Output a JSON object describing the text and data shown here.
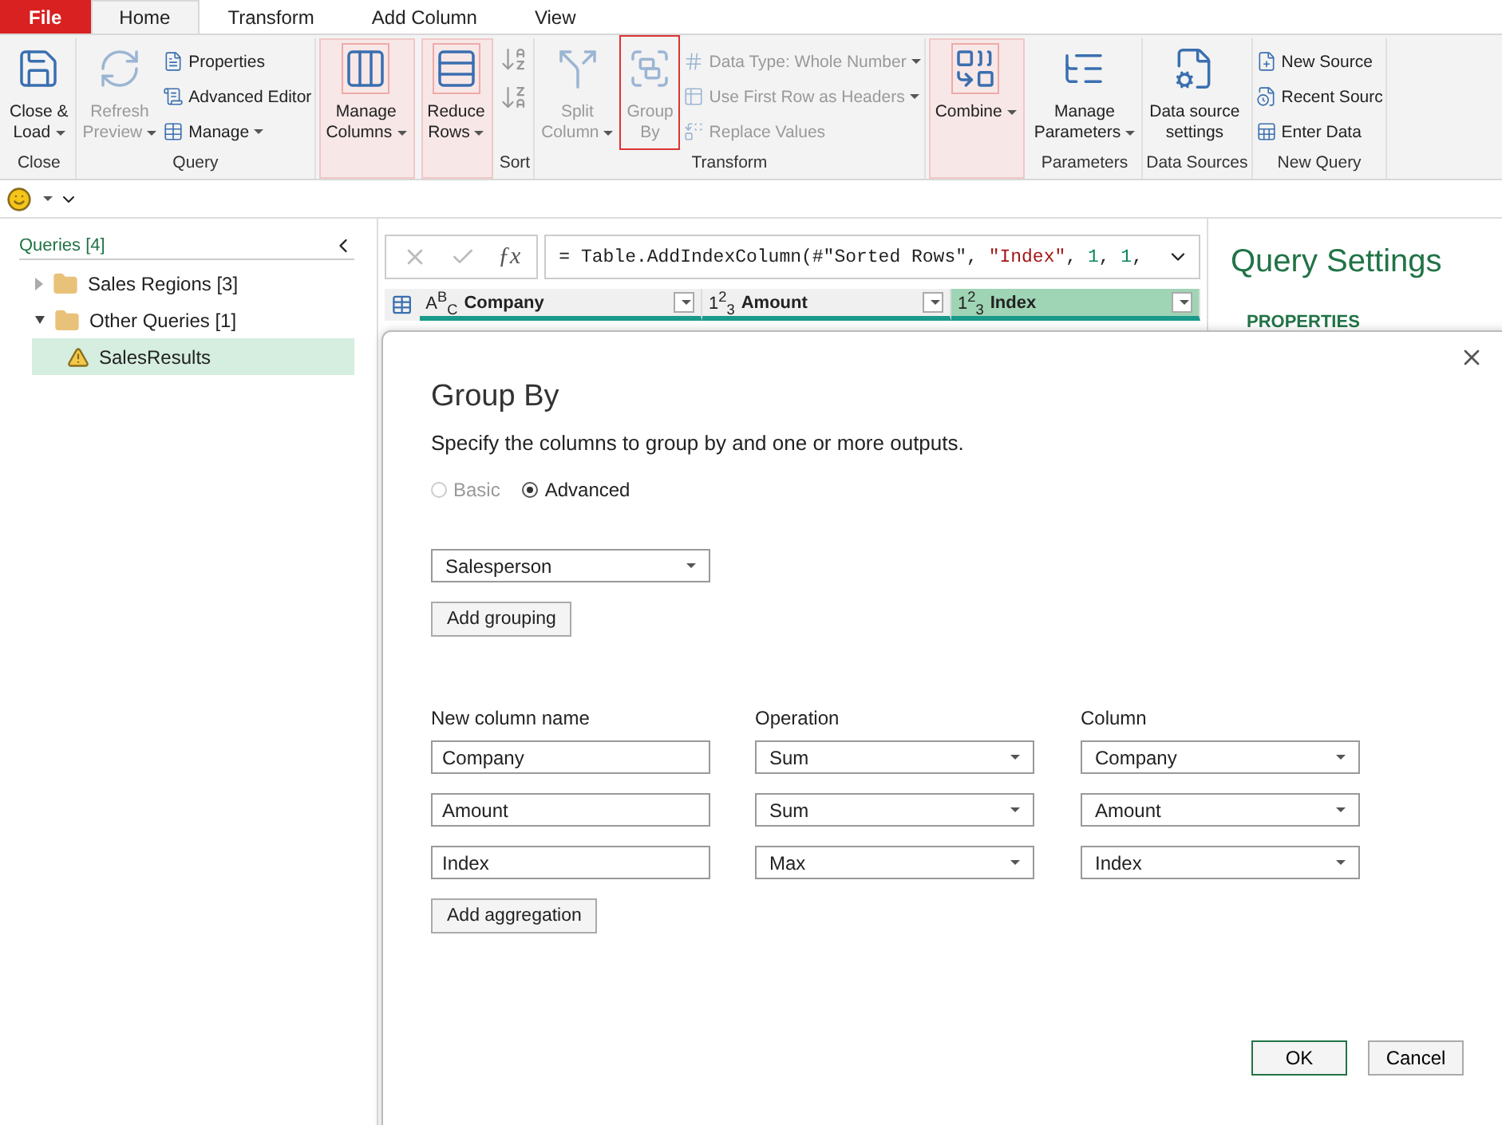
{
  "menu_tabs": [
    {
      "label": "File",
      "kind": "file",
      "selected": false
    },
    {
      "label": "Home",
      "kind": "tab",
      "selected": true
    },
    {
      "label": "Transform",
      "kind": "tab",
      "selected": false
    },
    {
      "label": "Add Column",
      "kind": "tab",
      "selected": false
    },
    {
      "label": "View",
      "kind": "tab",
      "selected": false
    }
  ],
  "ribbon": [
    {
      "label": "Close",
      "highlighted": false,
      "items": [
        {
          "kind": "large",
          "label": "Close &\nLoad",
          "dropdown": true,
          "disabled": false,
          "outlined": false
        }
      ]
    },
    {
      "label": "Query",
      "highlighted": false,
      "items": [
        {
          "kind": "large",
          "label": "Refresh\nPreview",
          "dropdown": true,
          "disabled": true,
          "outlined": false
        },
        {
          "kind": "stack",
          "items": [
            {
              "label": "Properties",
              "dropdown": false,
              "disabled": false
            },
            {
              "label": "Advanced Editor",
              "dropdown": false,
              "disabled": false
            },
            {
              "label": "Manage",
              "dropdown": true,
              "disabled": false
            }
          ]
        }
      ]
    },
    {
      "highlighted": true,
      "items": [
        {
          "kind": "large",
          "label": "Manage\nColumns",
          "dropdown": true,
          "disabled": false,
          "outlined": false
        }
      ]
    },
    {
      "highlighted": true,
      "items": [
        {
          "kind": "large",
          "label": "Reduce\nRows",
          "dropdown": true,
          "disabled": false,
          "outlined": false
        }
      ]
    },
    {
      "label": "Sort",
      "highlighted": false,
      "items": [
        {
          "kind": "icons"
        }
      ]
    },
    {
      "label": "Transform",
      "highlighted": false,
      "items": [
        {
          "kind": "large",
          "label": "Split\nColumn",
          "dropdown": true,
          "disabled": true,
          "outlined": false
        },
        {
          "kind": "large",
          "label": "Group\nBy",
          "dropdown": false,
          "disabled": true,
          "outlined": true
        },
        {
          "kind": "stack",
          "items": [
            {
              "label": "Data Type: Whole Number",
              "dropdown": true,
              "disabled": true
            },
            {
              "label": "Use First Row as Headers",
              "dropdown": true,
              "disabled": true
            },
            {
              "label": "Replace Values",
              "dropdown": false,
              "disabled": true
            }
          ]
        }
      ]
    },
    {
      "highlighted": true,
      "items": [
        {
          "kind": "large",
          "label": "Combine",
          "dropdown": true,
          "disabled": false,
          "outlined": false
        }
      ]
    },
    {
      "label": "Parameters",
      "highlighted": false,
      "items": [
        {
          "kind": "large",
          "label": "Manage\nParameters",
          "dropdown": true,
          "disabled": false,
          "outlined": false
        }
      ]
    },
    {
      "label": "Data Sources",
      "highlighted": false,
      "items": [
        {
          "kind": "large",
          "label": "Data source\nsettings",
          "dropdown": false,
          "disabled": false,
          "outlined": false
        }
      ]
    },
    {
      "label": "New Query",
      "highlighted": false,
      "items": [
        {
          "kind": "stack",
          "items": [
            {
              "label": "New Source",
              "dropdown": false,
              "disabled": false
            },
            {
              "label": "Recent Sourc",
              "dropdown": false,
              "disabled": false
            },
            {
              "label": "Enter Data",
              "dropdown": false,
              "disabled": false
            }
          ]
        }
      ]
    }
  ],
  "queries": {
    "title": "Queries [4]",
    "items": [
      {
        "label": "Sales Regions [3]",
        "kind": "folder",
        "expanded": false,
        "selected": false
      },
      {
        "label": "Other Queries [1]",
        "kind": "folder",
        "expanded": true,
        "selected": false,
        "children": [
          {
            "label": "SalesResults",
            "kind": "query",
            "warning": true,
            "selected": true
          }
        ]
      }
    ]
  },
  "function_label": "ƒx",
  "formula": [
    {
      "text": "= Table.AddIndexColumn(#\"Sorted Rows\", ",
      "kind": "plain"
    },
    {
      "text": "\"Index\"",
      "kind": "string"
    },
    {
      "text": ", ",
      "kind": "plain"
    },
    {
      "text": "1",
      "kind": "number"
    },
    {
      "text": ", ",
      "kind": "plain"
    },
    {
      "text": "1",
      "kind": "number"
    },
    {
      "text": ",",
      "kind": "plain"
    }
  ],
  "columns": [
    {
      "type": "A$^{B}$$_{C}$",
      "name": "Company",
      "selected": false
    },
    {
      "type": "1$^{2}$$_{3}$",
      "name": "Amount",
      "selected": false
    },
    {
      "type": "1$^{2}$$_{3}$",
      "name": "Index",
      "selected": true
    }
  ],
  "settings": {
    "title": "Query Settings",
    "section": "PROPERTIES"
  },
  "dialog": {
    "title": "Group By",
    "description": "Specify the columns to group by and one or more outputs.",
    "modes": [
      {
        "label": "Basic",
        "selected": false,
        "disabled": true
      },
      {
        "label": "Advanced",
        "selected": true,
        "disabled": false
      }
    ],
    "groupings": [
      "Salesperson"
    ],
    "add_grouping": "Add grouping",
    "headers": [
      "New column name",
      "Operation",
      "Column"
    ],
    "aggregations": [
      {
        "name": "Company",
        "operation": "Sum",
        "column": "Company"
      },
      {
        "name": "Amount",
        "operation": "Sum",
        "column": "Amount"
      },
      {
        "name": "Index",
        "operation": "Max",
        "column": "Index"
      }
    ],
    "add_aggregation": "Add aggregation",
    "buttons": [
      {
        "label": "OK",
        "kind": "primary"
      },
      {
        "label": "Cancel",
        "kind": "secondary"
      }
    ]
  }
}
